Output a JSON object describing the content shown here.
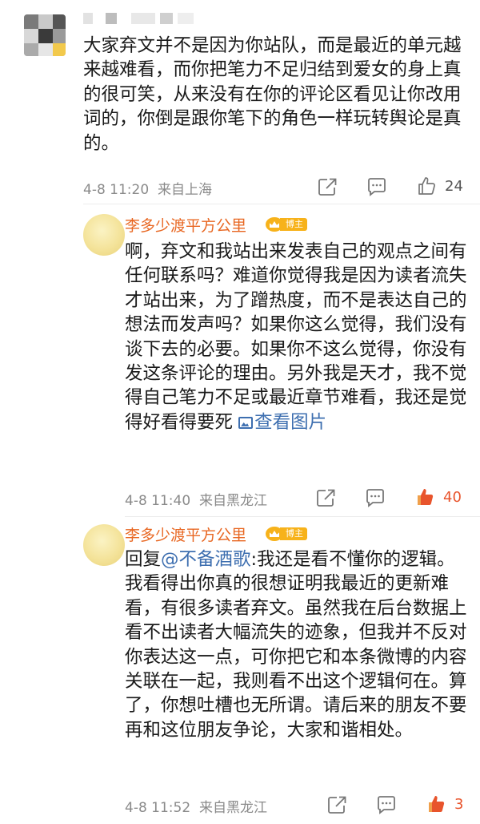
{
  "comments": [
    {
      "text": "大家弃文并不是因为你站队，而是最近的单元越来越难看，而你把笔力不足归结到爱女的身上真的很可笑，从来没有在你的评论区看见让你改用词的，你倒是跟你笔下的角色一样玩转舆论是真的。",
      "time": "4-8 11:20",
      "location": "来自上海",
      "likes": "24"
    },
    {
      "username": "李多少渡平方公里",
      "badge": "博主",
      "text": "啊，弃文和我站出来发表自己的观点之间有任何联系吗？难道你觉得我是因为读者流失才站出来，为了蹭热度，而不是表达自己的想法而发声吗？如果你这么觉得，我们没有谈下去的必要。如果你不这么觉得，你没有发这条评论的理由。另外我是天才，我不觉得自己笔力不足或最近章节难看，我还是觉得好看得要死",
      "view_pic": "查看图片",
      "time": "4-8 11:40",
      "location": "来自黑龙江",
      "likes": "40"
    },
    {
      "username": "李多少渡平方公里",
      "badge": "博主",
      "reply_prefix": "回复",
      "mention": "@不备酒歌",
      "text": ":我还是看不懂你的逻辑。我看得出你真的很想证明我最近的更新难看，有很多读者弃文。虽然我在后台数据上看不出读者大幅流失的迹象，但我并不反对你表达这一点，可你把它和本条微博的内容关联在一起，我则看不出这个逻辑何在。算了，你想吐槽也无所谓。请后来的朋友不要再和这位朋友争论，大家和谐相处。",
      "time": "4-8 11:52",
      "location": "来自黑龙江",
      "likes": "3"
    }
  ],
  "icons": {
    "share": "share-icon",
    "comment": "comment-icon",
    "like": "thumbs-up-icon"
  },
  "colors": {
    "username": "#e86722",
    "badge": "#f7b21a",
    "link": "#3e6fb0",
    "like_active": "#e8542c"
  }
}
